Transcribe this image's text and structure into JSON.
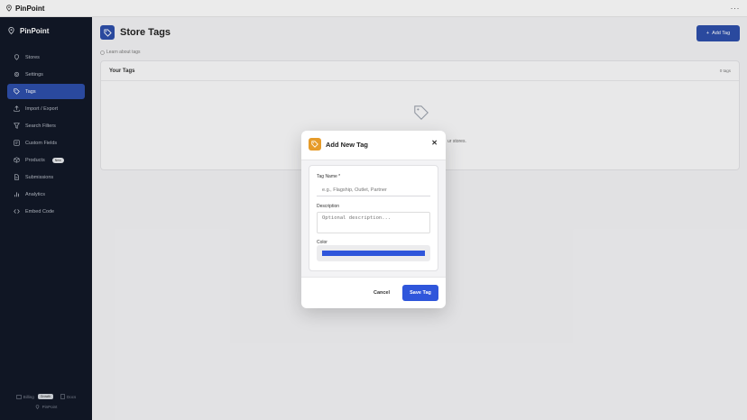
{
  "app": {
    "title": "PinPoint",
    "menu_icon": "more-dots-icon"
  },
  "sidebar": {
    "brand": "PinPoint",
    "items": [
      {
        "label": "Stores",
        "icon": "pin-icon"
      },
      {
        "label": "Settings",
        "icon": "gear-icon"
      },
      {
        "label": "Tags",
        "icon": "tag-icon",
        "active": true
      },
      {
        "label": "Import / Export",
        "icon": "upload-icon"
      },
      {
        "label": "Search Filters",
        "icon": "filter-icon"
      },
      {
        "label": "Custom Fields",
        "icon": "fields-icon"
      },
      {
        "label": "Products",
        "icon": "box-icon",
        "badge": "New"
      },
      {
        "label": "Submissions",
        "icon": "doc-icon"
      },
      {
        "label": "Analytics",
        "icon": "chart-icon"
      },
      {
        "label": "Embed Code",
        "icon": "code-icon"
      }
    ],
    "footer": {
      "billing": "Billing",
      "plan": "Growth",
      "docs": "Docs",
      "powered": "PinPoint"
    }
  },
  "main": {
    "page_title": "Store Tags",
    "learn_link": "Learn about tags",
    "add_button": "Add Tag",
    "card": {
      "title": "Your Tags",
      "count": "0 tags",
      "empty_text": "ur stores."
    }
  },
  "modal": {
    "title": "Add New Tag",
    "name_label": "Tag Name *",
    "name_placeholder": "e.g., Flagship, Outlet, Partner",
    "desc_label": "Description",
    "desc_placeholder": "Optional description...",
    "color_label": "Color",
    "color_value": "#2f56db",
    "cancel": "Cancel",
    "save": "Save Tag"
  },
  "colors": {
    "accent": "#2d4ea8",
    "sidebar_bg": "#111827",
    "tag_icon": "#e69b2a"
  }
}
